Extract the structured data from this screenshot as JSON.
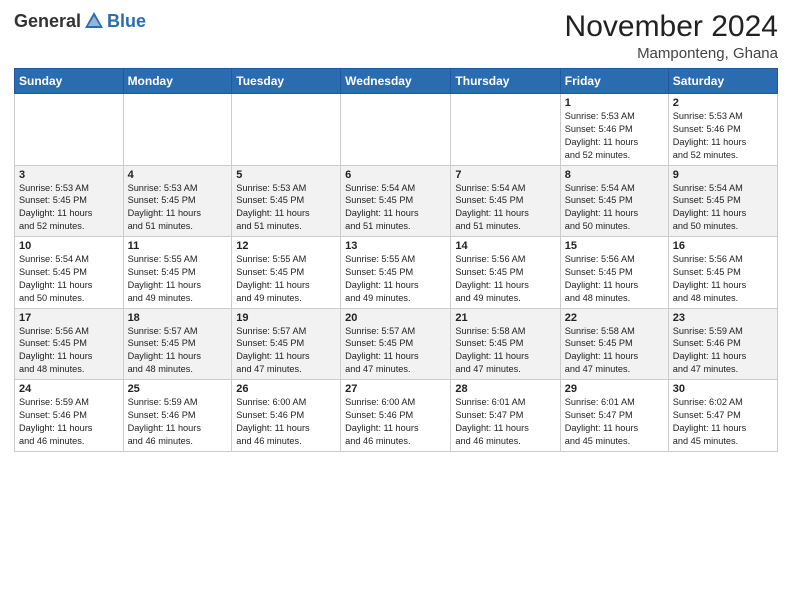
{
  "header": {
    "logo_general": "General",
    "logo_blue": "Blue",
    "month_title": "November 2024",
    "location": "Mamponteng, Ghana"
  },
  "weekdays": [
    "Sunday",
    "Monday",
    "Tuesday",
    "Wednesday",
    "Thursday",
    "Friday",
    "Saturday"
  ],
  "weeks": [
    [
      {
        "day": "",
        "info": ""
      },
      {
        "day": "",
        "info": ""
      },
      {
        "day": "",
        "info": ""
      },
      {
        "day": "",
        "info": ""
      },
      {
        "day": "",
        "info": ""
      },
      {
        "day": "1",
        "info": "Sunrise: 5:53 AM\nSunset: 5:46 PM\nDaylight: 11 hours\nand 52 minutes."
      },
      {
        "day": "2",
        "info": "Sunrise: 5:53 AM\nSunset: 5:46 PM\nDaylight: 11 hours\nand 52 minutes."
      }
    ],
    [
      {
        "day": "3",
        "info": "Sunrise: 5:53 AM\nSunset: 5:45 PM\nDaylight: 11 hours\nand 52 minutes."
      },
      {
        "day": "4",
        "info": "Sunrise: 5:53 AM\nSunset: 5:45 PM\nDaylight: 11 hours\nand 51 minutes."
      },
      {
        "day": "5",
        "info": "Sunrise: 5:53 AM\nSunset: 5:45 PM\nDaylight: 11 hours\nand 51 minutes."
      },
      {
        "day": "6",
        "info": "Sunrise: 5:54 AM\nSunset: 5:45 PM\nDaylight: 11 hours\nand 51 minutes."
      },
      {
        "day": "7",
        "info": "Sunrise: 5:54 AM\nSunset: 5:45 PM\nDaylight: 11 hours\nand 51 minutes."
      },
      {
        "day": "8",
        "info": "Sunrise: 5:54 AM\nSunset: 5:45 PM\nDaylight: 11 hours\nand 50 minutes."
      },
      {
        "day": "9",
        "info": "Sunrise: 5:54 AM\nSunset: 5:45 PM\nDaylight: 11 hours\nand 50 minutes."
      }
    ],
    [
      {
        "day": "10",
        "info": "Sunrise: 5:54 AM\nSunset: 5:45 PM\nDaylight: 11 hours\nand 50 minutes."
      },
      {
        "day": "11",
        "info": "Sunrise: 5:55 AM\nSunset: 5:45 PM\nDaylight: 11 hours\nand 49 minutes."
      },
      {
        "day": "12",
        "info": "Sunrise: 5:55 AM\nSunset: 5:45 PM\nDaylight: 11 hours\nand 49 minutes."
      },
      {
        "day": "13",
        "info": "Sunrise: 5:55 AM\nSunset: 5:45 PM\nDaylight: 11 hours\nand 49 minutes."
      },
      {
        "day": "14",
        "info": "Sunrise: 5:56 AM\nSunset: 5:45 PM\nDaylight: 11 hours\nand 49 minutes."
      },
      {
        "day": "15",
        "info": "Sunrise: 5:56 AM\nSunset: 5:45 PM\nDaylight: 11 hours\nand 48 minutes."
      },
      {
        "day": "16",
        "info": "Sunrise: 5:56 AM\nSunset: 5:45 PM\nDaylight: 11 hours\nand 48 minutes."
      }
    ],
    [
      {
        "day": "17",
        "info": "Sunrise: 5:56 AM\nSunset: 5:45 PM\nDaylight: 11 hours\nand 48 minutes."
      },
      {
        "day": "18",
        "info": "Sunrise: 5:57 AM\nSunset: 5:45 PM\nDaylight: 11 hours\nand 48 minutes."
      },
      {
        "day": "19",
        "info": "Sunrise: 5:57 AM\nSunset: 5:45 PM\nDaylight: 11 hours\nand 47 minutes."
      },
      {
        "day": "20",
        "info": "Sunrise: 5:57 AM\nSunset: 5:45 PM\nDaylight: 11 hours\nand 47 minutes."
      },
      {
        "day": "21",
        "info": "Sunrise: 5:58 AM\nSunset: 5:45 PM\nDaylight: 11 hours\nand 47 minutes."
      },
      {
        "day": "22",
        "info": "Sunrise: 5:58 AM\nSunset: 5:45 PM\nDaylight: 11 hours\nand 47 minutes."
      },
      {
        "day": "23",
        "info": "Sunrise: 5:59 AM\nSunset: 5:46 PM\nDaylight: 11 hours\nand 47 minutes."
      }
    ],
    [
      {
        "day": "24",
        "info": "Sunrise: 5:59 AM\nSunset: 5:46 PM\nDaylight: 11 hours\nand 46 minutes."
      },
      {
        "day": "25",
        "info": "Sunrise: 5:59 AM\nSunset: 5:46 PM\nDaylight: 11 hours\nand 46 minutes."
      },
      {
        "day": "26",
        "info": "Sunrise: 6:00 AM\nSunset: 5:46 PM\nDaylight: 11 hours\nand 46 minutes."
      },
      {
        "day": "27",
        "info": "Sunrise: 6:00 AM\nSunset: 5:46 PM\nDaylight: 11 hours\nand 46 minutes."
      },
      {
        "day": "28",
        "info": "Sunrise: 6:01 AM\nSunset: 5:47 PM\nDaylight: 11 hours\nand 46 minutes."
      },
      {
        "day": "29",
        "info": "Sunrise: 6:01 AM\nSunset: 5:47 PM\nDaylight: 11 hours\nand 45 minutes."
      },
      {
        "day": "30",
        "info": "Sunrise: 6:02 AM\nSunset: 5:47 PM\nDaylight: 11 hours\nand 45 minutes."
      }
    ]
  ]
}
